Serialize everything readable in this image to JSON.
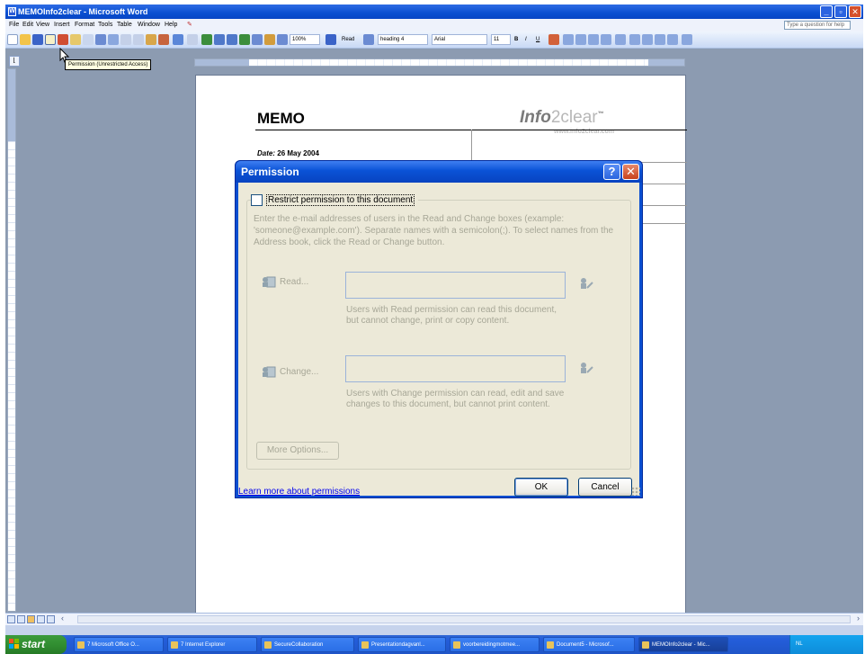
{
  "window": {
    "title": "MEMOInfo2clear - Microsoft Word",
    "controls": [
      "minimize",
      "maximize",
      "close"
    ]
  },
  "menubar": {
    "items": [
      "File",
      "Edit",
      "View",
      "Insert",
      "Format",
      "Tools",
      "Table",
      "Window",
      "Help"
    ],
    "help_placeholder": "Type a question for help"
  },
  "toolbar": {
    "zoom": "100%",
    "read_label": "Read",
    "style": "heading 4",
    "font": "Arial",
    "font_size": "11"
  },
  "tooltip": "Permission (Unrestricted Access)",
  "document": {
    "heading": "MEMO",
    "logo_prefix": "Info",
    "logo_circle": "2",
    "logo_suffix": "clear",
    "logo_tm": "™",
    "logo_url": "www.info2clear.com",
    "date_label": "Date:",
    "date_value": "26 May 2004"
  },
  "dialog": {
    "title": "Permission",
    "help_glyph": "?",
    "close_glyph": "✕",
    "restrict_label": "Restrict permission to this document",
    "instructions": "Enter the e-mail addresses of users in the Read and Change boxes (example: 'someone@example.com'). Separate names with a semicolon(;). To select names from the Address book, click the Read or Change button.",
    "read_label": "Read...",
    "read_description": "Users with Read permission can read this document, but cannot change, print or copy content.",
    "change_label": "Change...",
    "change_description": "Users with Change permission can read, edit and save changes to this document, but cannot print content.",
    "more_options": "More Options...",
    "learn_more": "Learn more about permissions",
    "ok": "OK",
    "cancel": "Cancel"
  },
  "taskbar": {
    "start": "start",
    "tasks": [
      "7 Microsoft Office O...",
      "7 Internet Explorer",
      "SecureCollaboration",
      "Presentationdagvanl...",
      "voorbereidingmotmee...",
      "Document5 - Microsof...",
      "MEMOInfo2clear - Mic..."
    ],
    "tray": "NL"
  },
  "colors": {
    "title_bar": "#0a4fd1",
    "dialog_face": "#ece9d8",
    "disabled_text": "#a7a797",
    "link": "#0000ee",
    "workspace": "#8c9bb1",
    "start_green": "#2f8b2f"
  }
}
